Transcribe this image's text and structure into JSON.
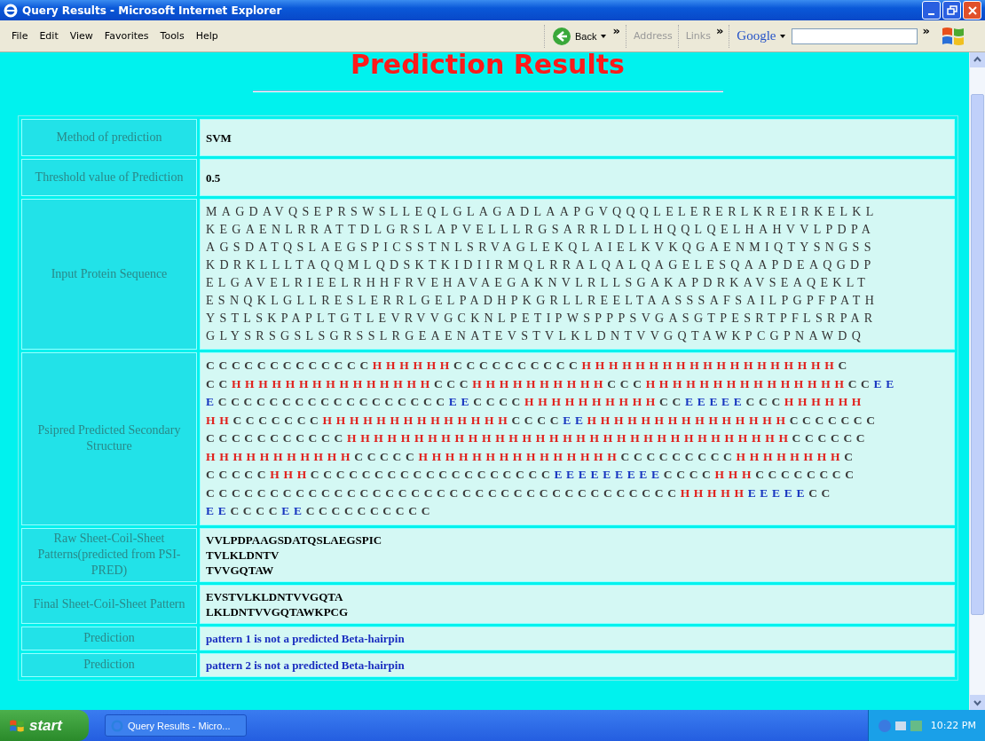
{
  "window": {
    "title": "Query Results - Microsoft Internet Explorer"
  },
  "menu": [
    "File",
    "Edit",
    "View",
    "Favorites",
    "Tools",
    "Help"
  ],
  "toolbar": {
    "back": "Back",
    "chevron_1": "»",
    "address": "Address",
    "links": "Links",
    "chevron_2": "»",
    "google": "Google",
    "chevron_3": "»"
  },
  "page": {
    "heading": "Prediction Results",
    "rows": [
      {
        "kind": "text",
        "label": "Method of prediction",
        "lines": [
          "SVM"
        ]
      },
      {
        "kind": "text",
        "label": "Threshold value of Prediction",
        "lines": [
          "0.5"
        ]
      },
      {
        "kind": "sequence",
        "label": "Input Protein Sequence",
        "lines": [
          "MAGDAVQSEPRSWSLLEQLGLAGADLAAPGVQQQLELERERLKREIRKELKL",
          "KEGAENLRRATTDLGRSLAPVELLLRGSARRLDLLHQQLQELHAHVVLPDPA",
          "AGSDATQSLAEGSPICSSTNLSRVAGLEKQLAIELKVKQGAENMIQTYSNGSS",
          "KDRKLLLTAQQMLQDSKTKIDIIRMQLRRALQALQAGELESQAAPDEAQGDP",
          "ELGAVELRIEELRHHFRVEHAVAEGAKNVLRLLSGAKAPDRKAVSEAQEKLT",
          "ESNQKLGLLRESLERRLGELPADHPKGRLLREELTAASSSAFSAILPGPFPATH",
          "YSTLSKPAPLTGTLEVRVVGCKNLPETIPWSPPPSVGASGTPESRTPFLSRPAR",
          "GLYSRSGSLSGRSSLRGEAENATEVSTVLKLDNTVVGQTAWKPCGPNAWDQ"
        ]
      },
      {
        "kind": "structure",
        "label": "Psipred Predicted Secondary Structure",
        "lines": [
          [
            {
              "kind": "coil",
              "text": "CCCCCCCCCCCCC"
            },
            {
              "kind": "helix",
              "text": "HHHHHH"
            },
            {
              "kind": "coil",
              "text": "CCCCCCCCCC"
            },
            {
              "kind": "helix",
              "text": "HHHHHHHHHHHHHHHHHHH"
            },
            {
              "kind": "coil",
              "text": "C"
            }
          ],
          [
            {
              "kind": "coil",
              "text": "CC"
            },
            {
              "kind": "helix",
              "text": "HHHHHHHHHHHHHHH"
            },
            {
              "kind": "coil",
              "text": "CCC"
            },
            {
              "kind": "helix",
              "text": "HHHHHHHHHH"
            },
            {
              "kind": "coil",
              "text": "CCC"
            },
            {
              "kind": "helix",
              "text": "HHHHHHHHHHHHHHH"
            },
            {
              "kind": "coil",
              "text": "CC"
            },
            {
              "kind": "strand",
              "text": "EE"
            }
          ],
          [
            {
              "kind": "strand",
              "text": "E"
            },
            {
              "kind": "coil",
              "text": "CCCCCCCCCCCCCCCCCC"
            },
            {
              "kind": "strand",
              "text": "EE"
            },
            {
              "kind": "coil",
              "text": "CCCC"
            },
            {
              "kind": "helix",
              "text": "HHHHHHHHHH"
            },
            {
              "kind": "coil",
              "text": "CC"
            },
            {
              "kind": "strand",
              "text": "EEEEE"
            },
            {
              "kind": "coil",
              "text": "CCC"
            },
            {
              "kind": "helix",
              "text": "HHHHHH"
            }
          ],
          [
            {
              "kind": "helix",
              "text": "HH"
            },
            {
              "kind": "coil",
              "text": "CCCCCCC"
            },
            {
              "kind": "helix",
              "text": "HHHHHHHHHHHHHH"
            },
            {
              "kind": "coil",
              "text": "CCCC"
            },
            {
              "kind": "strand",
              "text": "EE"
            },
            {
              "kind": "helix",
              "text": "HHHHHHHHHHHHHHH"
            },
            {
              "kind": "coil",
              "text": "CCCCCCC"
            }
          ],
          [
            {
              "kind": "coil",
              "text": "CCCCCCCCCCC"
            },
            {
              "kind": "helix",
              "text": "HHHHHHHHHHHHHHHHHHHHHHHHHHHHHHHHH"
            },
            {
              "kind": "coil",
              "text": "CCCCCC"
            }
          ],
          [
            {
              "kind": "helix",
              "text": "HHHHHHHHHHH"
            },
            {
              "kind": "coil",
              "text": "CCCCC"
            },
            {
              "kind": "helix",
              "text": "HHHHHHHHHHHHHHH"
            },
            {
              "kind": "coil",
              "text": "CCCCCCCCC"
            },
            {
              "kind": "helix",
              "text": "HHHHHHHH"
            },
            {
              "kind": "coil",
              "text": "C"
            }
          ],
          [
            {
              "kind": "coil",
              "text": "CCCCC"
            },
            {
              "kind": "helix",
              "text": "HHH"
            },
            {
              "kind": "coil",
              "text": "CCCCCCCCCCCCCCCCCCC"
            },
            {
              "kind": "strand",
              "text": "EEEEEEEEE"
            },
            {
              "kind": "coil",
              "text": "CCCC"
            },
            {
              "kind": "helix",
              "text": "HHH"
            },
            {
              "kind": "coil",
              "text": "CCCCCCCC"
            }
          ],
          [
            {
              "kind": "coil",
              "text": "CCCCCCCCCCCCCCCCCCCCCCCCCCCCCCCCCCCCC"
            },
            {
              "kind": "helix",
              "text": "HHHHH"
            },
            {
              "kind": "strand",
              "text": "EEEEE"
            },
            {
              "kind": "coil",
              "text": "CC"
            }
          ],
          [
            {
              "kind": "strand",
              "text": "EE"
            },
            {
              "kind": "coil",
              "text": "CCCC"
            },
            {
              "kind": "strand",
              "text": "EE"
            },
            {
              "kind": "coil",
              "text": "CCCCCCCCCC"
            }
          ]
        ]
      },
      {
        "kind": "text",
        "label": "Raw Sheet-Coil-Sheet Patterns(predicted from PSI-PRED)",
        "lines": [
          "VVLPDPAAGSDATQSLAEGSPIC",
          "TVLKLDNTV",
          "TVVGQTAW"
        ]
      },
      {
        "kind": "text",
        "label": "Final Sheet-Coil-Sheet Pattern",
        "lines": [
          "EVSTVLKLDNTVVGQTA",
          "LKLDNTVVGQTAWKPCG"
        ]
      },
      {
        "kind": "result",
        "label": "Prediction",
        "lines": [
          "pattern 1 is not a predicted Beta-hairpin"
        ]
      },
      {
        "kind": "result",
        "label": "Prediction",
        "lines": [
          "pattern 2 is not a predicted Beta-hairpin"
        ]
      }
    ]
  },
  "taskbar": {
    "start": "start",
    "task": "Query Results - Micro...",
    "time": "10:22 PM"
  }
}
